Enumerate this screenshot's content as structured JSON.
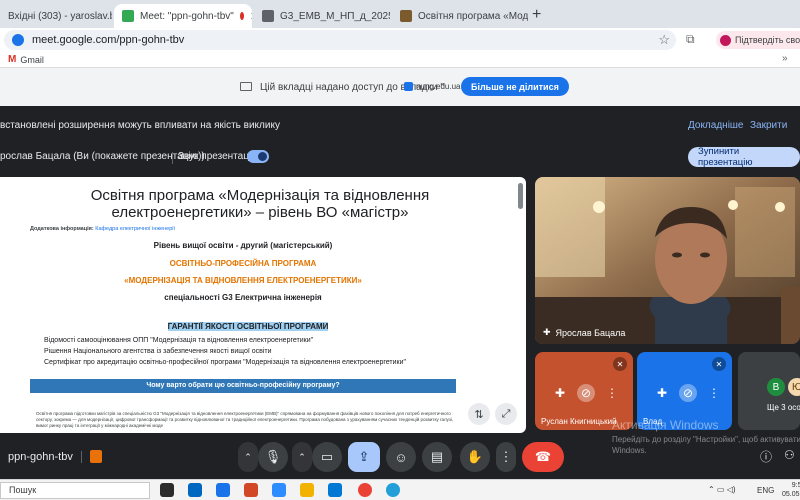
{
  "browser": {
    "tabs": [
      {
        "title": "Вхідні (303) - yaroslav.batsala@",
        "active": false
      },
      {
        "title": "Meet: \"ppn-gohn-tbv\"",
        "active": true
      },
      {
        "title": "G3_ЕМВ_М_НП_д_2025.pdf",
        "active": false
      },
      {
        "title": "Освітня програма «Моде",
        "active": false
      }
    ],
    "url": "meet.google.com/ppn-gohn-tbv",
    "verify_button": "Підтвердіть свою ос",
    "bookmark": "Gmail",
    "overflow_label": "»"
  },
  "share_bar": {
    "message": "Цій вкладці надано доступ до вкладки \"",
    "shared_tab": "nung.edu.ua",
    "stop_sharing_label": "Більше не ділитися"
  },
  "notice": {
    "text": "встановлені розширення можуть впливати на якість виклику",
    "more_label": "Докладніше",
    "close_label": "Закрити"
  },
  "presenting": {
    "text": "рослав Бацала (Ви (покажете презентацію))",
    "sound_label": "Звук презентації",
    "stop_label": "Зупинити презентацію"
  },
  "document": {
    "title": "Освітня програма «Модернізація та відновлення електроенергетики» – рівень ВО «магістр»",
    "additional_label": "Додаткова інформація:",
    "additional_link": "Кафедра електричної інженерії",
    "level": "Рівень вищої освіти - другий (магістерський)",
    "program_type": "ОСВІТНЬО-ПРОФЕСІЙНА ПРОГРАМА",
    "program_name": "«МОДЕРНІЗАЦІЯ ТА ВІДНОВЛЕННЯ ЕЛЕКТРОЕНЕРГЕТИКИ»",
    "specialty": "спеціальності G3 Електрична інженерія",
    "guarantees": "ГАРАНТІЇ ЯКОСТІ ОСВІТНЬОЇ ПРОГРАМИ",
    "list": [
      "Відомості самооцінювання ОПП \"Модернізація та відновлення електроенергетики\"",
      "Рішення Національного агентства із забезпечення якості вищої освіти",
      "Сертифікат про акредитацію освітньо-професійної програми \"Модернізація та відновлення електроенергетики\""
    ],
    "why_heading": "Чому варто обрати цю освітньо-професійну програму?",
    "paragraph": "Освітня програма підготовки магістрів за спеціальністю G3 \"Модернізація та відновлення електроенергетики (ЕМВ)\" спрямована на формування фахівців нового покоління для потреб енергетичного сектору, зокрема — для модернізації, цифрової трансформації та розвитку відновлюваної та традиційної електроенергетики. Програма побудована з урахуванням сучасних тенденцій розвитку галузі, вимог ринку праці та інтеграції у міжнародні академічні моде"
  },
  "participants": {
    "main_name": "Ярослав Бацала",
    "tiles": [
      {
        "name": "Руслан Книгницький",
        "color": "#c5522e"
      },
      {
        "name": "Влад",
        "color": "#1a73e8"
      }
    ],
    "avatar_letters": [
      "В",
      "Ю"
    ],
    "others_label": "Ще 3 особ"
  },
  "watermark": {
    "title": "Активація Windows",
    "line": "Перейдіть до розділу \"Настройки\", щоб активувати Windows."
  },
  "controls": {
    "meeting_code": "ppn-gohn-tbv"
  },
  "taskbar": {
    "search_placeholder": "Пошук",
    "language": "ENG",
    "time": "9:52",
    "date": "05.05.2"
  },
  "colors": {
    "accent": "#1a73e8",
    "leave": "#ea4335",
    "orange_text": "#e37400",
    "heading_band": "#2f77b6"
  }
}
